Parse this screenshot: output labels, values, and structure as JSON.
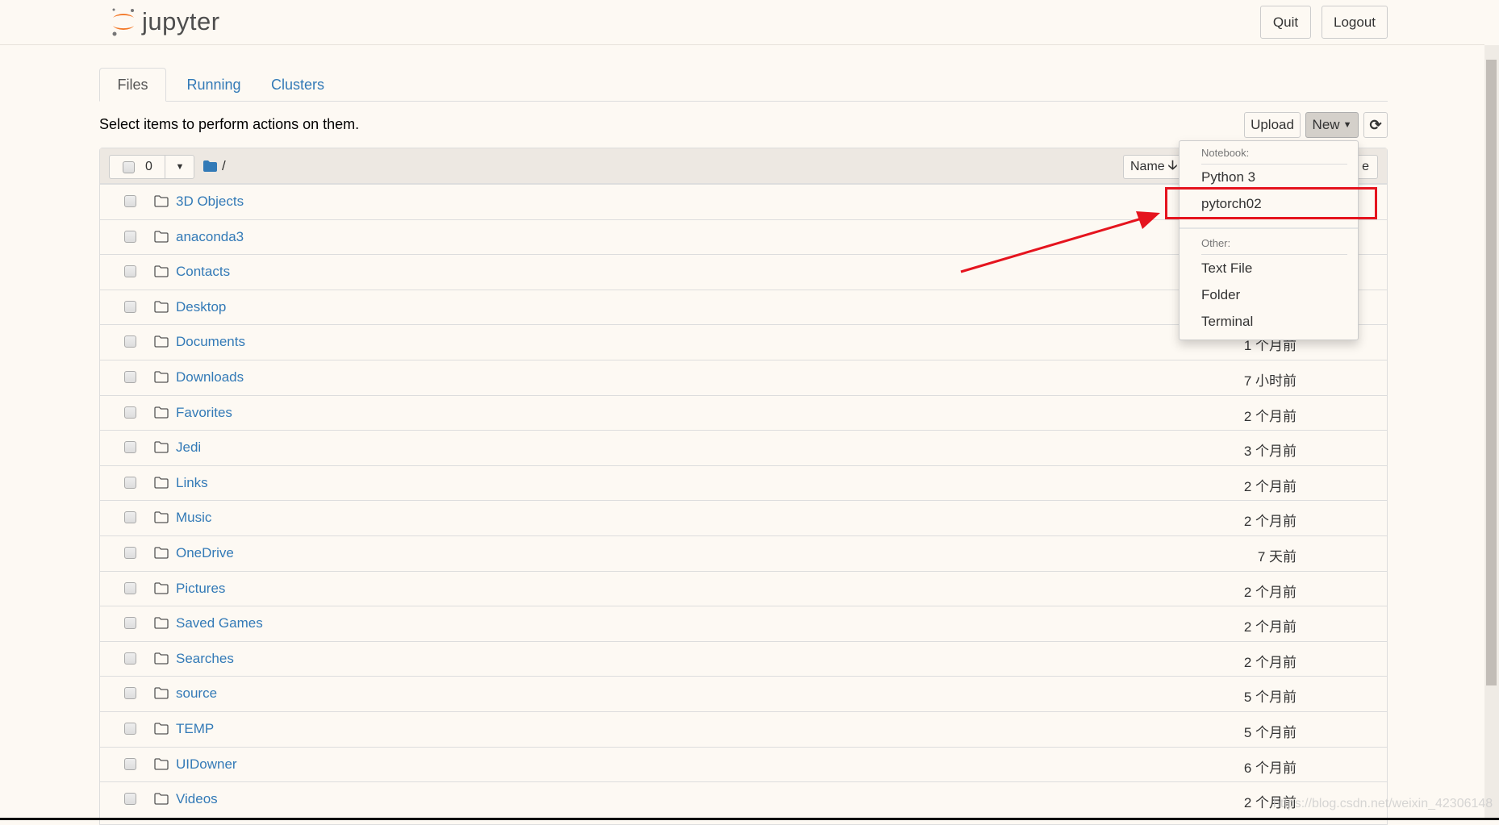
{
  "header": {
    "logo_text": "jupyter",
    "quit_label": "Quit",
    "logout_label": "Logout"
  },
  "tabs": [
    {
      "label": "Files",
      "active": true
    },
    {
      "label": "Running"
    },
    {
      "label": "Clusters"
    }
  ],
  "hint": "Select items to perform actions on them.",
  "toolbar": {
    "upload_label": "Upload",
    "new_label": "New",
    "refresh_icon": "refresh-icon"
  },
  "list_header": {
    "selected_count": "0",
    "breadcrumb": "/",
    "name_sort": "Name",
    "size_sort_partial": "e"
  },
  "files": [
    {
      "name": "3D Objects",
      "date": ""
    },
    {
      "name": "anaconda3",
      "date": ""
    },
    {
      "name": "Contacts",
      "date": ""
    },
    {
      "name": "Desktop",
      "date": ""
    },
    {
      "name": "Documents",
      "date": "1 个月前"
    },
    {
      "name": "Downloads",
      "date": "7 小时前"
    },
    {
      "name": "Favorites",
      "date": "2 个月前"
    },
    {
      "name": "Jedi",
      "date": "3 个月前"
    },
    {
      "name": "Links",
      "date": "2 个月前"
    },
    {
      "name": "Music",
      "date": "2 个月前"
    },
    {
      "name": "OneDrive",
      "date": "7 天前"
    },
    {
      "name": "Pictures",
      "date": "2 个月前"
    },
    {
      "name": "Saved Games",
      "date": "2 个月前"
    },
    {
      "name": "Searches",
      "date": "2 个月前"
    },
    {
      "name": "source",
      "date": "5 个月前"
    },
    {
      "name": "TEMP",
      "date": "5 个月前"
    },
    {
      "name": "UIDowner",
      "date": "6 个月前"
    },
    {
      "name": "Videos",
      "date": "2 个月前"
    }
  ],
  "new_menu": {
    "notebook_header": "Notebook:",
    "notebook_items": [
      "Python 3",
      "pytorch02"
    ],
    "other_header": "Other:",
    "other_items": [
      "Text File",
      "Folder",
      "Terminal"
    ],
    "highlighted": "pytorch02"
  },
  "annotation_color": "#e5141e",
  "watermark": "https://blog.csdn.net/weixin_42306148"
}
